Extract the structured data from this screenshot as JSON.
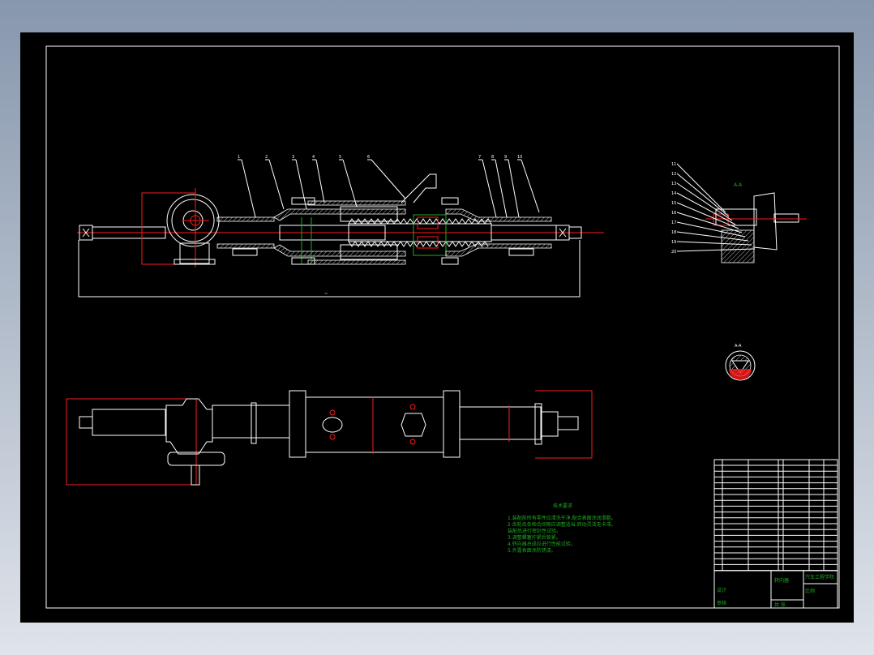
{
  "drawing": {
    "title": "齿轮齿条转向器装配图",
    "sheet_bg": "#000000",
    "line_color": "#ffffff",
    "dim_color": "#ff1a1a",
    "text_color": "#1faa1f"
  },
  "balloons": [
    "1",
    "2",
    "3",
    "4",
    "5",
    "6",
    "7",
    "8",
    "9",
    "10"
  ],
  "side_balloons": [
    "11",
    "12",
    "13",
    "14",
    "15",
    "16",
    "17",
    "18",
    "19",
    "20"
  ],
  "section_label": "A-A",
  "requirements": {
    "title": "技术要求",
    "lines": [
      "1.装配前所有零件应清洗干净,配合表面涂润滑脂。",
      "2.齿轮齿条啮合间隙应调整适当,转动灵活无卡滞。",
      "  装配后进行密封性试验。",
      "3.调整螺塞拧紧后锁紧。",
      "4.转向器总成应进行性能试验。",
      "5.外露表面涂防锈漆。"
    ]
  },
  "title_block": {
    "name": "转向器",
    "school": "汽车工程学院",
    "design": "设计",
    "check": "审核",
    "scale": "比例",
    "sheet": "共 张"
  }
}
